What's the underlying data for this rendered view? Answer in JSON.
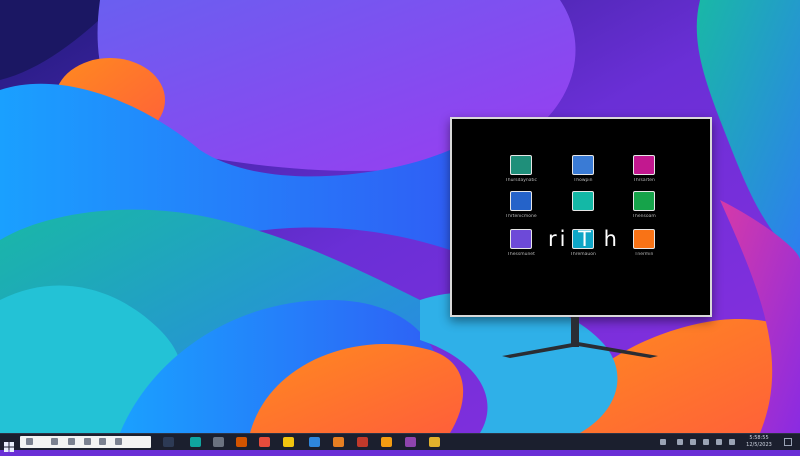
{
  "overlay_text": "ri T h",
  "desktop_icons": [
    {
      "label": "Thursdaynatic",
      "icon": "monitor-app-icon",
      "color": "#1f8f7a"
    },
    {
      "label": "Thowpin",
      "icon": "image-app-icon",
      "color": "#3a7bd5"
    },
    {
      "label": "Thrsarten",
      "icon": "pink-app-icon",
      "color": "#c2188f"
    },
    {
      "label": "Thrtenicmone",
      "icon": "blue-doc-icon",
      "color": "#2563c9"
    },
    {
      "label": "",
      "icon": "mascot-app-icon",
      "color": "#14b8a6"
    },
    {
      "label": "Thensoam",
      "icon": "green-app-icon",
      "color": "#16a34a"
    },
    {
      "label": "Thessmunet",
      "icon": "purple-app-icon",
      "color": "#6d4ad8"
    },
    {
      "label": "Thremauon",
      "icon": "tile-app-icon",
      "color": "#0ea5c6"
    },
    {
      "label": "Tnermin",
      "icon": "photo-app-icon",
      "color": "#f97316"
    }
  ],
  "taskbar": {
    "start_icon": "windows-start-icon",
    "search_text": "",
    "apps": [
      {
        "icon": "task-view-icon",
        "color": "#2d3a55"
      },
      {
        "icon": "edge-icon",
        "color": "#0fa5a0"
      },
      {
        "icon": "settings-icon",
        "color": "#6b7280"
      },
      {
        "icon": "mail-icon",
        "color": "#d35400"
      },
      {
        "icon": "store-icon",
        "color": "#e74c3c"
      },
      {
        "icon": "files-icon",
        "color": "#f1c40f"
      },
      {
        "icon": "word-icon",
        "color": "#2e86de"
      },
      {
        "icon": "photos-icon",
        "color": "#e67e22"
      },
      {
        "icon": "media-icon",
        "color": "#c0392b"
      },
      {
        "icon": "game-icon",
        "color": "#f39c12"
      },
      {
        "icon": "terminal-icon",
        "color": "#8e44ad"
      },
      {
        "icon": "notes-icon",
        "color": "#e1b12c"
      }
    ],
    "clock": {
      "time": "5:58:55",
      "date": "12/5/2023"
    }
  }
}
